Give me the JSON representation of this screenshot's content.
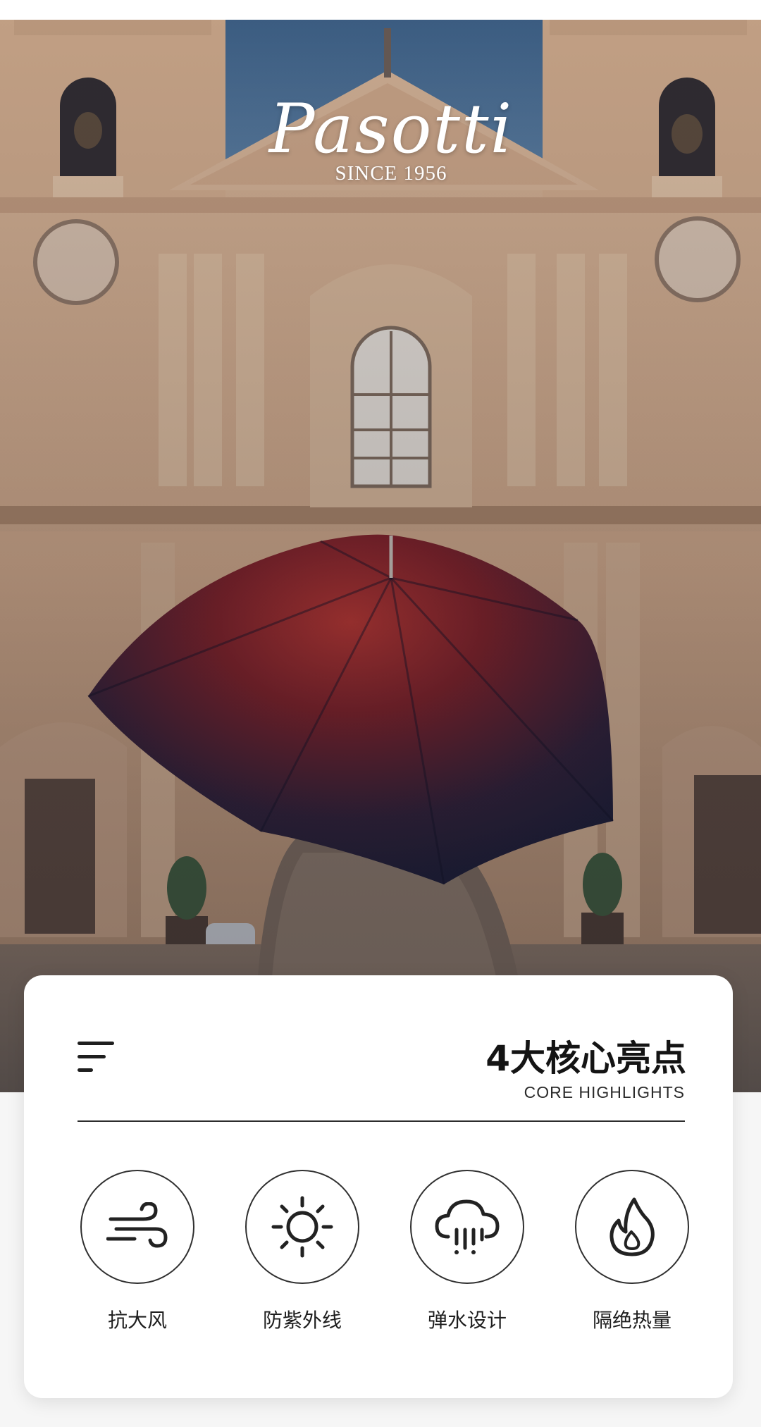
{
  "brand": {
    "logo_text": "Pasotti",
    "since_text": "SINCE 1956"
  },
  "hero": {
    "image_description_icon": "cathedral-umbrella-photo"
  },
  "highlights": {
    "menu_icon": "menu-lines-icon",
    "title": "4大核心亮点",
    "subtitle": "CORE HIGHLIGHTS",
    "items": [
      {
        "icon": "wind-icon",
        "label": "抗大风"
      },
      {
        "icon": "sun-icon",
        "label": "防紫外线"
      },
      {
        "icon": "rain-cloud-icon",
        "label": "弹水设计"
      },
      {
        "icon": "flame-icon",
        "label": "隔绝热量"
      }
    ]
  },
  "colors": {
    "card_background": "#ffffff",
    "text_dark": "#141414",
    "umbrella_red": "#8e1f22",
    "umbrella_navy": "#1c1d3a"
  }
}
